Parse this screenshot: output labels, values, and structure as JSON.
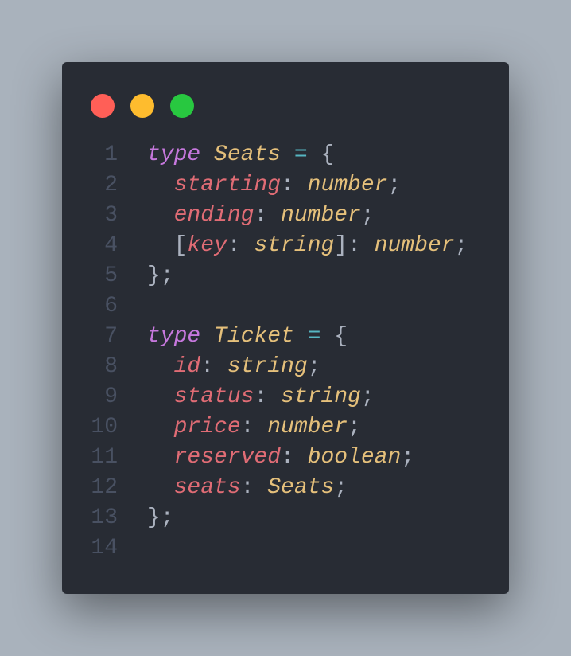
{
  "window": {
    "buttons": [
      {
        "name": "close",
        "color": "#ff5f57"
      },
      {
        "name": "minimize",
        "color": "#febc2e"
      },
      {
        "name": "maximize",
        "color": "#28c840"
      }
    ]
  },
  "colors": {
    "keyword": "#c678dd",
    "type": "#e5c07b",
    "prop": "#e06c75",
    "op": "#56b6c2",
    "punct": "#abb2bf"
  },
  "lines": [
    {
      "n": "1",
      "tokens": [
        [
          "keyword",
          "type",
          1
        ],
        [
          "punct",
          " ",
          0
        ],
        [
          "type",
          "Seats",
          1
        ],
        [
          "punct",
          " ",
          0
        ],
        [
          "op",
          "=",
          0
        ],
        [
          "punct",
          " {",
          0
        ]
      ]
    },
    {
      "n": "2",
      "tokens": [
        [
          "punct",
          "  ",
          0
        ],
        [
          "prop",
          "starting",
          1
        ],
        [
          "punct",
          ": ",
          0
        ],
        [
          "type",
          "number",
          1
        ],
        [
          "punct",
          ";",
          0
        ]
      ]
    },
    {
      "n": "3",
      "tokens": [
        [
          "punct",
          "  ",
          0
        ],
        [
          "prop",
          "ending",
          1
        ],
        [
          "punct",
          ": ",
          0
        ],
        [
          "type",
          "number",
          1
        ],
        [
          "punct",
          ";",
          0
        ]
      ]
    },
    {
      "n": "4",
      "tokens": [
        [
          "punct",
          "  [",
          0
        ],
        [
          "prop",
          "key",
          1
        ],
        [
          "punct",
          ": ",
          0
        ],
        [
          "type",
          "string",
          1
        ],
        [
          "punct",
          "]: ",
          0
        ],
        [
          "type",
          "number",
          1
        ],
        [
          "punct",
          ";",
          0
        ]
      ]
    },
    {
      "n": "5",
      "tokens": [
        [
          "punct",
          "};",
          0
        ]
      ]
    },
    {
      "n": "6",
      "tokens": []
    },
    {
      "n": "7",
      "tokens": [
        [
          "keyword",
          "type",
          1
        ],
        [
          "punct",
          " ",
          0
        ],
        [
          "type",
          "Ticket",
          1
        ],
        [
          "punct",
          " ",
          0
        ],
        [
          "op",
          "=",
          0
        ],
        [
          "punct",
          " {",
          0
        ]
      ]
    },
    {
      "n": "8",
      "tokens": [
        [
          "punct",
          "  ",
          0
        ],
        [
          "prop",
          "id",
          1
        ],
        [
          "punct",
          ": ",
          0
        ],
        [
          "type",
          "string",
          1
        ],
        [
          "punct",
          ";",
          0
        ]
      ]
    },
    {
      "n": "9",
      "tokens": [
        [
          "punct",
          "  ",
          0
        ],
        [
          "prop",
          "status",
          1
        ],
        [
          "punct",
          ": ",
          0
        ],
        [
          "type",
          "string",
          1
        ],
        [
          "punct",
          ";",
          0
        ]
      ]
    },
    {
      "n": "10",
      "tokens": [
        [
          "punct",
          "  ",
          0
        ],
        [
          "prop",
          "price",
          1
        ],
        [
          "punct",
          ": ",
          0
        ],
        [
          "type",
          "number",
          1
        ],
        [
          "punct",
          ";",
          0
        ]
      ]
    },
    {
      "n": "11",
      "tokens": [
        [
          "punct",
          "  ",
          0
        ],
        [
          "prop",
          "reserved",
          1
        ],
        [
          "punct",
          ": ",
          0
        ],
        [
          "type",
          "boolean",
          1
        ],
        [
          "punct",
          ";",
          0
        ]
      ]
    },
    {
      "n": "12",
      "tokens": [
        [
          "punct",
          "  ",
          0
        ],
        [
          "prop",
          "seats",
          1
        ],
        [
          "punct",
          ": ",
          0
        ],
        [
          "type",
          "Seats",
          1
        ],
        [
          "punct",
          ";",
          0
        ]
      ]
    },
    {
      "n": "13",
      "tokens": [
        [
          "punct",
          "};",
          0
        ]
      ]
    },
    {
      "n": "14",
      "tokens": []
    }
  ]
}
